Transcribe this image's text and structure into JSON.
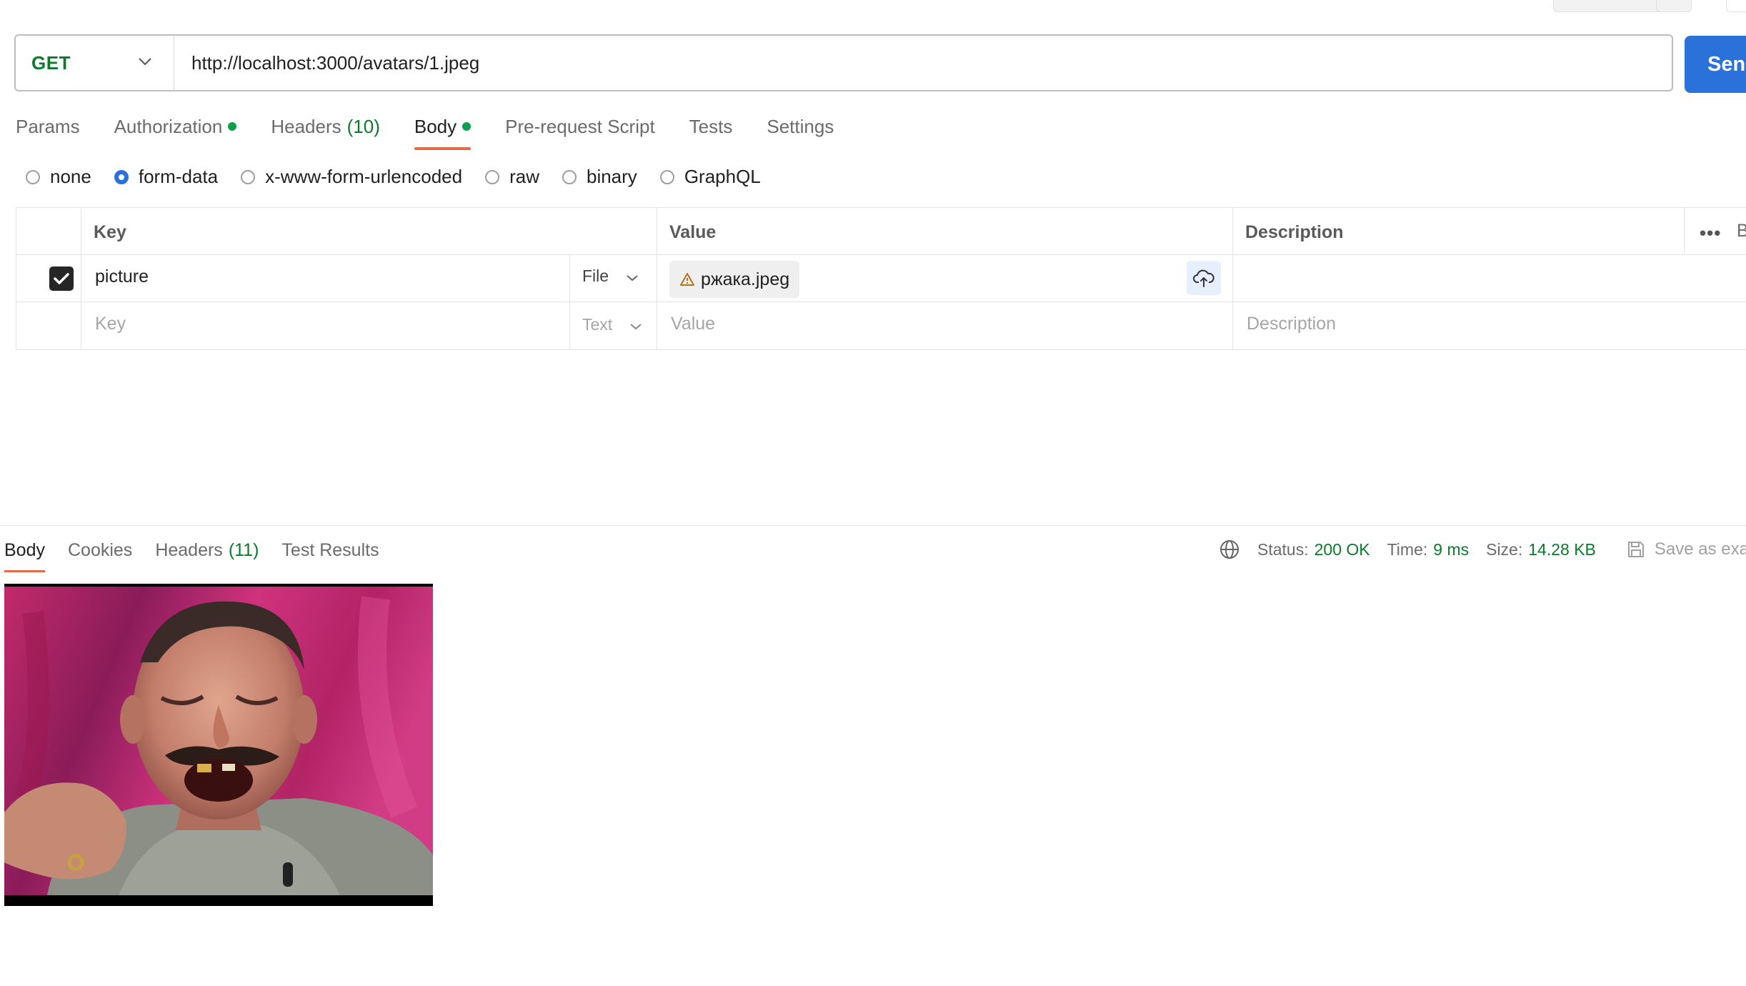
{
  "request": {
    "method": "GET",
    "url": "http://localhost:3000/avatars/1.jpeg",
    "send_label": "Sen"
  },
  "request_tabs": [
    {
      "label": "Params",
      "count": "",
      "dot": false,
      "active": false
    },
    {
      "label": "Authorization",
      "count": "",
      "dot": true,
      "active": false
    },
    {
      "label": "Headers",
      "count": "(10)",
      "dot": false,
      "active": false
    },
    {
      "label": "Body",
      "count": "",
      "dot": true,
      "active": true
    },
    {
      "label": "Pre-request Script",
      "count": "",
      "dot": false,
      "active": false
    },
    {
      "label": "Tests",
      "count": "",
      "dot": false,
      "active": false
    },
    {
      "label": "Settings",
      "count": "",
      "dot": false,
      "active": false
    }
  ],
  "body_modes": [
    {
      "label": "none",
      "checked": false
    },
    {
      "label": "form-data",
      "checked": true
    },
    {
      "label": "x-www-form-urlencoded",
      "checked": false
    },
    {
      "label": "raw",
      "checked": false
    },
    {
      "label": "binary",
      "checked": false
    },
    {
      "label": "GraphQL",
      "checked": false
    }
  ],
  "form_table": {
    "headers": {
      "key": "Key",
      "value": "Value",
      "description": "Description",
      "bulk": "B"
    },
    "rows": [
      {
        "checked": true,
        "key": "picture",
        "type": "File",
        "value": "ржака.jpeg",
        "description": ""
      },
      {
        "checked": false,
        "key_placeholder": "Key",
        "type": "Text",
        "value_placeholder": "Value",
        "description_placeholder": "Description"
      }
    ]
  },
  "response": {
    "tabs": [
      {
        "label": "Body",
        "count": "",
        "active": true
      },
      {
        "label": "Cookies",
        "count": "",
        "active": false
      },
      {
        "label": "Headers",
        "count": "(11)",
        "active": false
      },
      {
        "label": "Test Results",
        "count": "",
        "active": false
      }
    ],
    "status_label": "Status:",
    "status_value": "200 OK",
    "time_label": "Time:",
    "time_value": "9 ms",
    "size_label": "Size:",
    "size_value": "14.28 KB",
    "save_label": "Save as exa"
  },
  "colors": {
    "accent": "#2a72d9",
    "tab_underline": "#e2694a",
    "success": "#0b7a2a",
    "dot": "#0aa04b"
  },
  "icons": [
    "chevron-down-icon",
    "warning-icon",
    "cloud-upload-icon",
    "more-icon",
    "globe-icon",
    "save-icon",
    "checkmark-icon"
  ]
}
